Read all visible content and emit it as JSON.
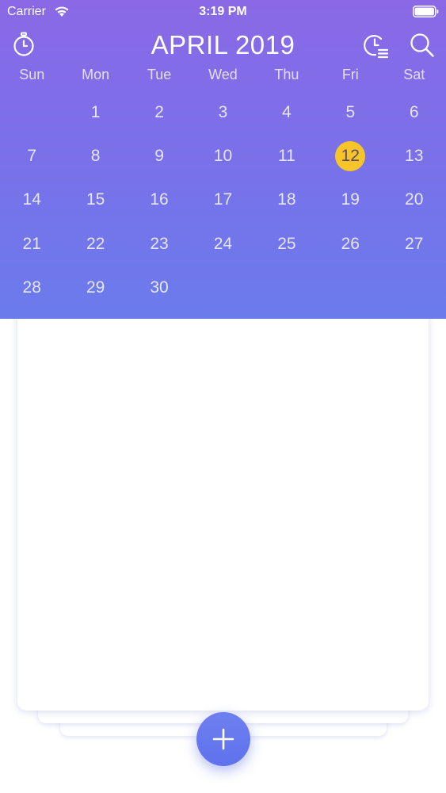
{
  "status_bar": {
    "carrier": "Carrier",
    "time": "3:19 PM",
    "wifi_icon": "wifi-icon",
    "battery_icon": "battery-icon"
  },
  "header": {
    "title": "APRIL 2019",
    "left_icon": "stopwatch-icon",
    "right_icons": [
      "clock-list-icon",
      "search-icon"
    ]
  },
  "calendar": {
    "weekdays": [
      "Sun",
      "Mon",
      "Tue",
      "Wed",
      "Thu",
      "Fri",
      "Sat"
    ],
    "leading_blank_days": 1,
    "days": [
      "1",
      "2",
      "3",
      "4",
      "5",
      "6",
      "7",
      "8",
      "9",
      "10",
      "11",
      "12",
      "13",
      "14",
      "15",
      "16",
      "17",
      "18",
      "19",
      "20",
      "21",
      "22",
      "23",
      "24",
      "25",
      "26",
      "27",
      "28",
      "29",
      "30"
    ],
    "selected_day": "12"
  },
  "colors": {
    "header_top": "#8a68e6",
    "header_bottom": "#6a7bec",
    "today_highlight": "#f7c52a",
    "fab": "#6373ed"
  },
  "fab": {
    "icon": "plus-icon"
  }
}
